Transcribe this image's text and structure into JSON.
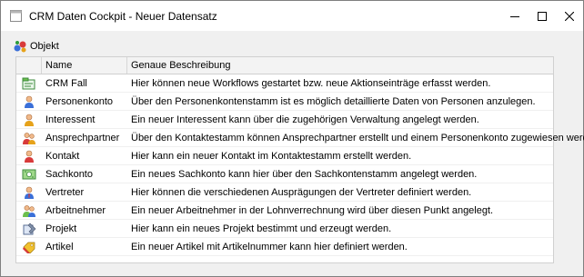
{
  "window": {
    "title": "CRM Daten Cockpit - Neuer Datensatz",
    "icons": {
      "app": "window-app-icon",
      "minimize": "minimize-icon",
      "maximize": "maximize-icon",
      "close": "close-icon"
    }
  },
  "group": {
    "label": "Objekt",
    "icon": "object-group-icon"
  },
  "table": {
    "columns": [
      "Name",
      "Genaue Beschreibung"
    ],
    "rows": [
      {
        "icon": "crm-case-icon",
        "name": "CRM Fall",
        "description": "Hier können neue Workflows gestartet bzw. neue Aktionseinträge erfasst werden."
      },
      {
        "icon": "person-account-icon",
        "name": "Personenkonto",
        "description": "Über den Personenkontenstamm ist es möglich detaillierte Daten von Personen anzulegen."
      },
      {
        "icon": "prospect-icon",
        "name": "Interessent",
        "description": "Ein neuer Interessent kann über die zugehörigen Verwaltung angelegt werden."
      },
      {
        "icon": "contact-person-icon",
        "name": "Ansprechpartner",
        "description": "Über den Kontaktestamm können Ansprechpartner erstellt und einem Personenkonto zugewiesen werden."
      },
      {
        "icon": "contact-icon",
        "name": "Kontakt",
        "description": "Hier kann ein neuer Kontakt im Kontaktestamm erstellt werden."
      },
      {
        "icon": "ledger-account-icon",
        "name": "Sachkonto",
        "description": "Ein neues Sachkonto kann hier über den Sachkontenstamm angelegt werden."
      },
      {
        "icon": "representative-icon",
        "name": "Vertreter",
        "description": "Hier können die verschiedenen Ausprägungen der Vertreter definiert werden."
      },
      {
        "icon": "employee-icon",
        "name": "Arbeitnehmer",
        "description": "Ein neuer Arbeitnehmer in der Lohnverrechnung wird über diesen Punkt angelegt."
      },
      {
        "icon": "project-icon",
        "name": "Projekt",
        "description": "Hier kann ein neues Projekt bestimmt und erzeugt werden."
      },
      {
        "icon": "article-icon",
        "name": "Artikel",
        "description": "Ein neuer Artikel mit Artikelnummer kann hier definiert werden."
      }
    ]
  }
}
